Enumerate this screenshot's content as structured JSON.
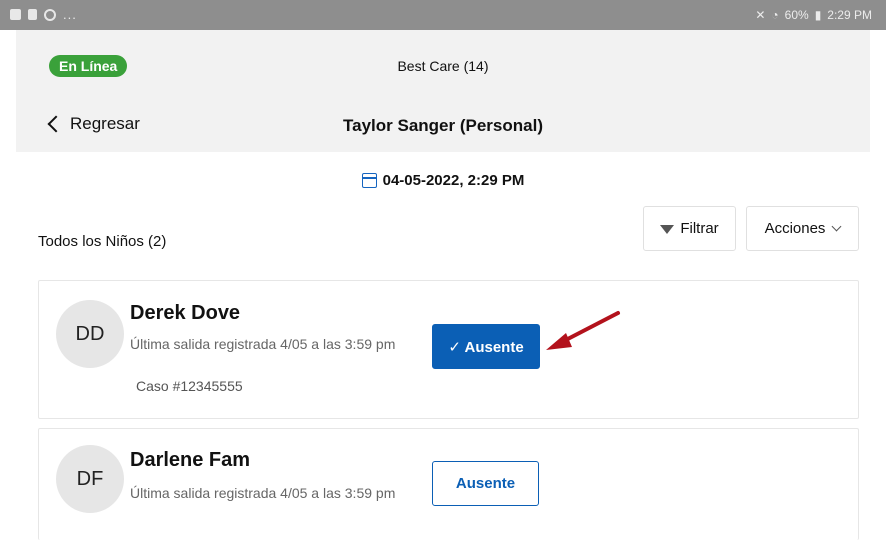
{
  "status_bar": {
    "left_dots": "...",
    "battery": "60%",
    "time": "2:29 PM"
  },
  "header": {
    "badge": "En Línea",
    "org": "Best Care (14)",
    "back_label": "Regresar",
    "person": "Taylor Sanger (Personal)"
  },
  "date": "04-05-2022, 2:29 PM",
  "toolbar": {
    "section_title": "Todos los Niños (2)",
    "filter_label": "Filtrar",
    "actions_label": "Acciones"
  },
  "children": [
    {
      "initials": "DD",
      "name": "Derek Dove",
      "last_checkout": "Última salida registrada 4/05 a las 3:59 pm",
      "case": "Caso #12345555",
      "absent_label": "✓ Ausente",
      "absent_selected": true
    },
    {
      "initials": "DF",
      "name": "Darlene Fam",
      "last_checkout": "Última salida registrada 4/05 a las 3:59 pm",
      "absent_label": "Ausente",
      "absent_selected": false
    }
  ],
  "colors": {
    "badge_green": "#3aa13a",
    "primary_blue": "#0b5fb5",
    "arrow_red": "#b3121c"
  },
  "icons": [
    "image-icon",
    "sim-icon",
    "sync-icon",
    "mute-icon",
    "wifi-icon",
    "battery-icon",
    "back-chevron-icon",
    "calendar-icon",
    "filter-icon",
    "chevron-down-icon",
    "annotation-arrow-icon"
  ]
}
